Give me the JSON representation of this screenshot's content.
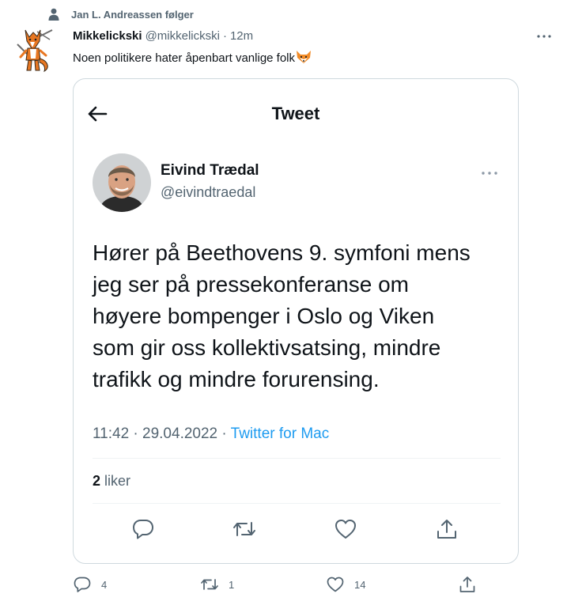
{
  "social_context": {
    "icon": "person-icon",
    "text": "Jan L. Andreassen følger"
  },
  "tweet": {
    "author_name": "Mikkelickski",
    "author_handle": "@mikkelickski",
    "separator": "·",
    "time": "12m",
    "text": "Noen politikere hater åpenbart vanlige folk",
    "emoji": "fox-face-icon"
  },
  "quoted_screenshot": {
    "title": "Tweet",
    "author_name": "Eivind Trædal",
    "author_handle": "@eivindtraedal",
    "text_lines": [
      "Hører på Beethovens 9. symfoni mens",
      "jeg ser på pressekonferanse om",
      "høyere bompenger i Oslo og Viken",
      "som gir oss kollektivsatsing, mindre",
      "trafikk og mindre forurensing."
    ],
    "timestamp": "11:42 · 29.04.2022 · ",
    "source": "Twitter for Mac",
    "likes_count": "2",
    "likes_label": " liker"
  },
  "actions": {
    "reply_count": "4",
    "retweet_count": "1",
    "like_count": "14"
  },
  "colors": {
    "text_primary": "#0f1419",
    "text_secondary": "#536471",
    "accent": "#1d9bf0",
    "border": "#cfd9de"
  }
}
